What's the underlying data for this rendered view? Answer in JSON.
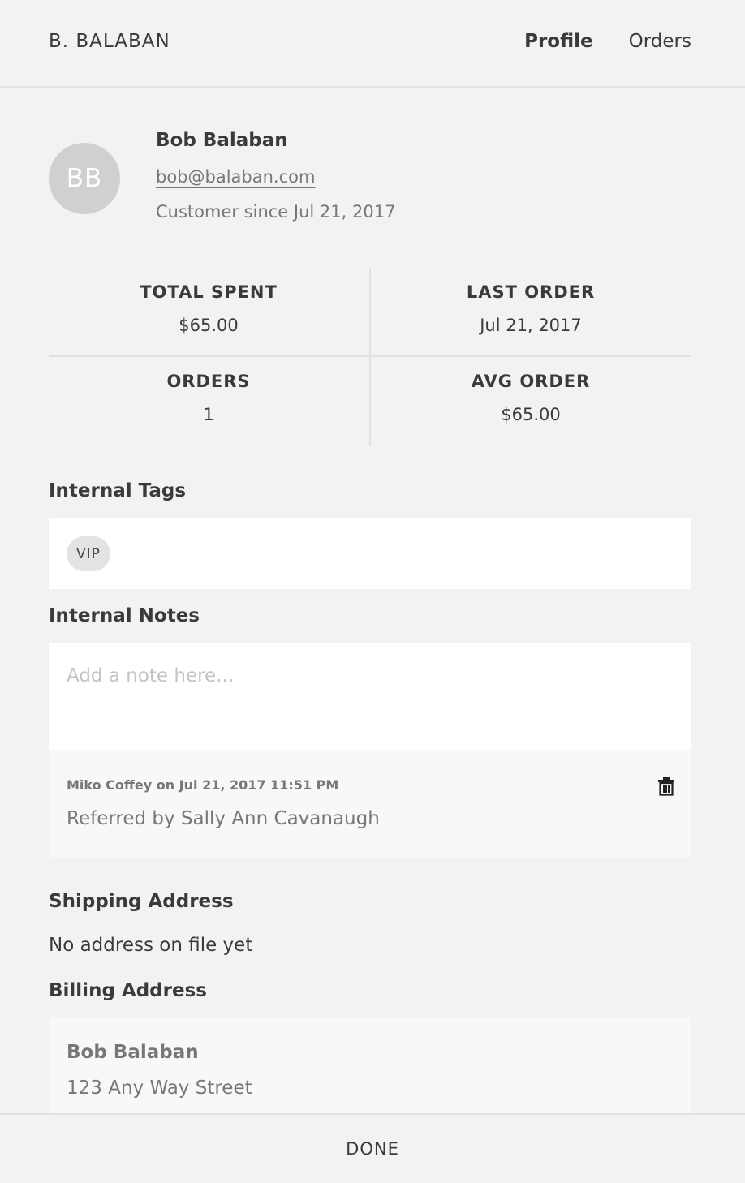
{
  "header": {
    "title": "B. BALABAN",
    "nav": [
      {
        "label": "Profile",
        "active": true
      },
      {
        "label": "Orders",
        "active": false
      }
    ]
  },
  "customer": {
    "initials": "BB",
    "name": "Bob Balaban",
    "email": "bob@balaban.com",
    "since": "Customer since Jul 21, 2017"
  },
  "stats": [
    {
      "label": "TOTAL SPENT",
      "value": "$65.00"
    },
    {
      "label": "LAST ORDER",
      "value": "Jul 21, 2017"
    },
    {
      "label": "ORDERS",
      "value": "1"
    },
    {
      "label": "AVG ORDER",
      "value": "$65.00"
    }
  ],
  "internal_tags": {
    "title": "Internal Tags",
    "tags": [
      "VIP"
    ]
  },
  "internal_notes": {
    "title": "Internal Notes",
    "placeholder": "Add a note here...",
    "notes": [
      {
        "meta": "Miko Coffey on Jul 21, 2017 11:51 PM",
        "text": "Referred by Sally Ann Cavanaugh",
        "delete_icon": "trash-icon"
      }
    ]
  },
  "shipping": {
    "title": "Shipping Address",
    "text": "No address on file yet"
  },
  "billing": {
    "title": "Billing Address",
    "name": "Bob Balaban",
    "line1": "123 Any Way Street"
  },
  "footer": {
    "done_label": "DONE"
  }
}
